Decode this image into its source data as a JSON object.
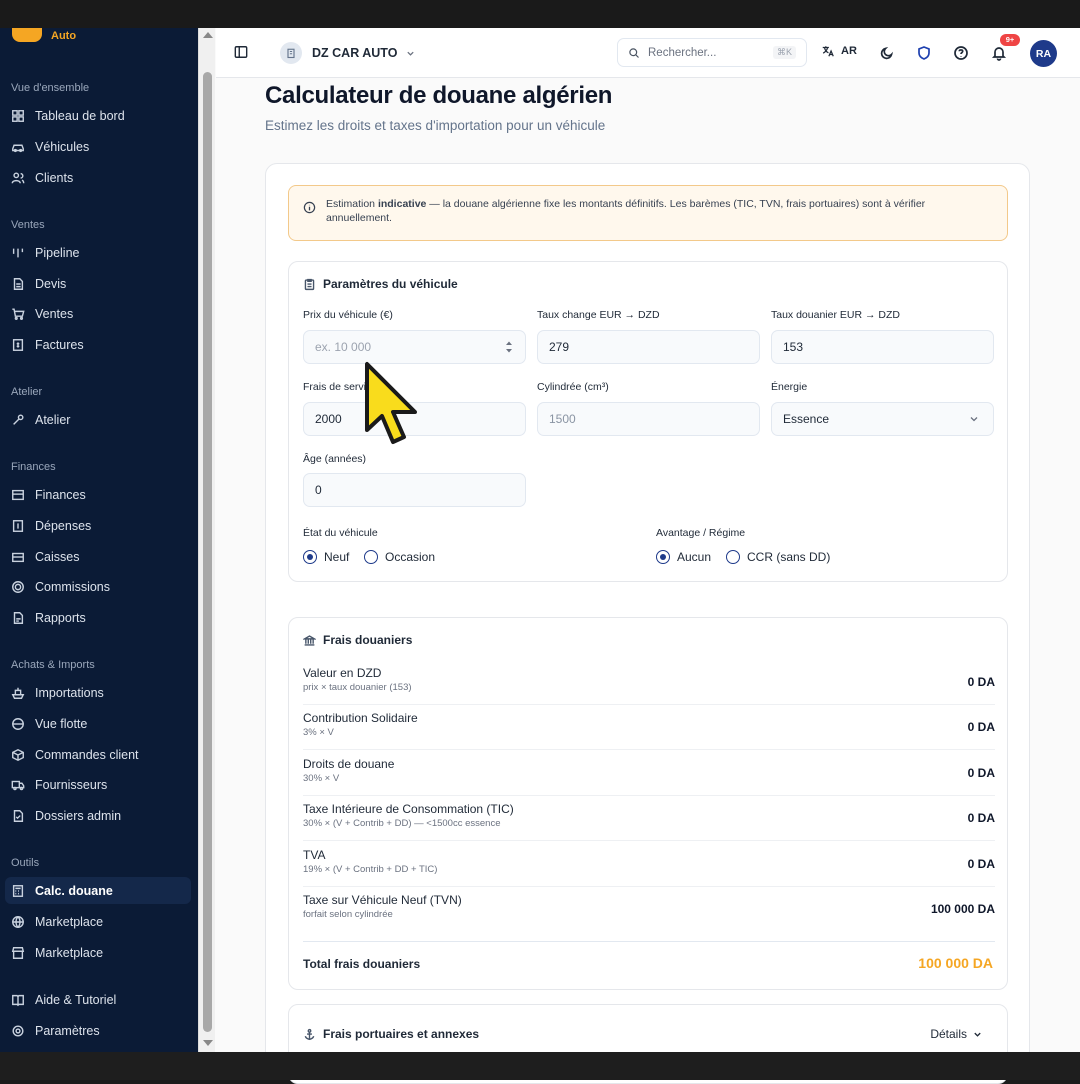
{
  "sidebar": {
    "logo_text": "Auto",
    "sections": [
      {
        "title": "Vue d'ensemble",
        "items": [
          "Tableau de bord",
          "Véhicules",
          "Clients"
        ]
      },
      {
        "title": "Ventes",
        "items": [
          "Pipeline",
          "Devis",
          "Ventes",
          "Factures"
        ]
      },
      {
        "title": "Atelier",
        "items": [
          "Atelier"
        ]
      },
      {
        "title": "Finances",
        "items": [
          "Finances",
          "Dépenses",
          "Caisses",
          "Commissions",
          "Rapports"
        ]
      },
      {
        "title": "Achats & Imports",
        "items": [
          "Importations",
          "Vue flotte",
          "Commandes client",
          "Fournisseurs",
          "Dossiers admin"
        ]
      },
      {
        "title": "Outils",
        "items": [
          "Calc. douane",
          "Marketplace",
          "Marketplace"
        ]
      },
      {
        "title": "",
        "items": [
          "Aide & Tutoriel",
          "Paramètres"
        ]
      }
    ],
    "active_item": "Calc. douane"
  },
  "header": {
    "brand": "DZ CAR AUTO",
    "search_placeholder": "Rechercher...",
    "search_shortcut": "⌘K",
    "language": "AR",
    "notifications_badge": "9+",
    "avatar_initials": "RA"
  },
  "page": {
    "title": "Calculateur de douane algérien",
    "subtitle": "Estimez les droits et taxes d'importation pour un véhicule"
  },
  "alert": {
    "prefix": "Estimation ",
    "emphasis": "indicative",
    "rest": " — la douane algérienne fixe les montants définitifs. Les barèmes (TIC, TVN, frais portuaires) sont à vérifier annuellement."
  },
  "params": {
    "title": "Paramètres du véhicule",
    "price_label": "Prix du véhicule (€)",
    "price_placeholder": "ex. 10 000",
    "exchange_label": "Taux change EUR → DZD",
    "exchange_value": "279",
    "customs_rate_label": "Taux douanier EUR → DZD",
    "customs_rate_value": "153",
    "service_fee_label": "Frais de servi",
    "service_fee_value": "2000",
    "displacement_label": "Cylindrée (cm³)",
    "displacement_value": "1500",
    "energy_label": "Énergie",
    "energy_value": "Essence",
    "age_label": "Âge (années)",
    "age_value": "0",
    "state_label": "État du véhicule",
    "state_options": [
      "Neuf",
      "Occasion"
    ],
    "state_selected": "Neuf",
    "regime_label": "Avantage / Régime",
    "regime_options": [
      "Aucun",
      "CCR (sans DD)"
    ],
    "regime_selected": "Aucun"
  },
  "fees": {
    "title": "Frais douaniers",
    "rows": [
      {
        "label": "Valeur en DZD",
        "sub": "prix × taux douanier (153)",
        "value": "0 DA"
      },
      {
        "label": "Contribution Solidaire",
        "sub": "3% × V",
        "value": "0 DA"
      },
      {
        "label": "Droits de douane",
        "sub": "30% × V",
        "value": "0 DA"
      },
      {
        "label": "Taxe Intérieure de Consommation (TIC)",
        "sub": "30% × (V + Contrib + DD) — <1500cc essence",
        "value": "0 DA"
      },
      {
        "label": "TVA",
        "sub": "19% × (V + Contrib + DD + TIC)",
        "value": "0 DA"
      },
      {
        "label": "Taxe sur Véhicule Neuf (TVN)",
        "sub": "forfait selon cylindrée",
        "value": "100 000 DA"
      }
    ],
    "total_label": "Total frais douaniers",
    "total_value": "100 000 DA"
  },
  "port": {
    "title": "Frais portuaires et annexes",
    "details_label": "Détails"
  },
  "colors": {
    "sidebar_bg": "#0b1b36",
    "accent": "#f5a623",
    "primary": "#1e3a8a",
    "alert_bg": "#fff8ed",
    "alert_border": "#f3c98a"
  }
}
